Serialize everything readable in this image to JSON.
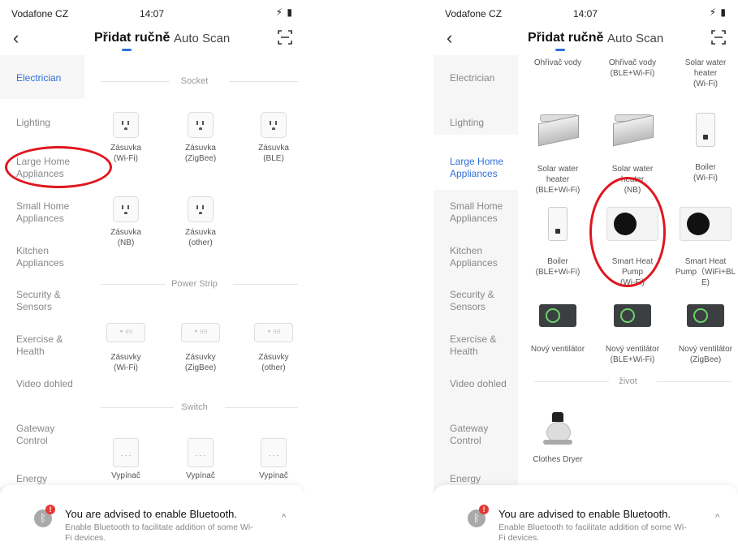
{
  "status": {
    "carrier": "Vodafone CZ",
    "time": "14:07",
    "icons": "⚡︎ ▮"
  },
  "nav": {
    "back": "‹",
    "tab_manual": "Přidat ručně",
    "tab_auto": "Auto Scan"
  },
  "sidebar": {
    "items": [
      "Electrician",
      "Lighting",
      "Large Home Appliances",
      "Small Home Appliances",
      "Kitchen Appliances",
      "Security & Sensors",
      "Exercise & Health",
      "Video dohled",
      "Gateway Control",
      "Energy"
    ]
  },
  "left": {
    "sections": {
      "socket": "Socket",
      "power_strip": "Power Strip",
      "switch": "Switch"
    },
    "sockets": [
      {
        "label": "Zásuvka",
        "sub": "(Wi-Fi)"
      },
      {
        "label": "Zásuvka",
        "sub": "(ZigBee)"
      },
      {
        "label": "Zásuvka",
        "sub": "(BLE)"
      },
      {
        "label": "Zásuvka",
        "sub": "(NB)"
      },
      {
        "label": "Zásuvka",
        "sub": "(other)"
      }
    ],
    "strips": [
      {
        "label": "Zásuvky",
        "sub": "(Wi-Fi)"
      },
      {
        "label": "Zásuvky",
        "sub": "(ZigBee)"
      },
      {
        "label": "Zásuvky",
        "sub": "(other)"
      }
    ],
    "switches": [
      "Vypínač",
      "Vypínač",
      "Vypínač"
    ]
  },
  "right": {
    "top_partial": [
      "Ohřivač vody",
      "Ohřivač vody\n(BLE+Wi-Fi)",
      "Solar water\nheater\n(Wi-Fi)"
    ],
    "row1": [
      "Solar water\nheater\n(BLE+Wi-Fi)",
      "Solar water\nheater\n(NB)",
      "Boiler\n(Wi-Fi)"
    ],
    "row2": [
      "Boiler\n(BLE+Wi-Fi)",
      "Smart Heat\nPump\n(Wi-Fi)",
      "Smart Heat\nPump（WiFi+BL\nE)"
    ],
    "row3": [
      "Nový ventilátor",
      "Nový ventilátor\n(BLE+Wi-Fi)",
      "Nový ventilátor\n(ZigBee)"
    ],
    "section_zivot": "život",
    "dryer": "Clothes Dryer"
  },
  "banner": {
    "title": "You are advised to enable Bluetooth.",
    "sub": "Enable Bluetooth to facilitate addition of some Wi-Fi devices.",
    "badge": "!",
    "chevron": "^"
  },
  "colors": {
    "accent": "#2f6fd8",
    "annotation": "#e0161e",
    "alert": "#e53935"
  }
}
